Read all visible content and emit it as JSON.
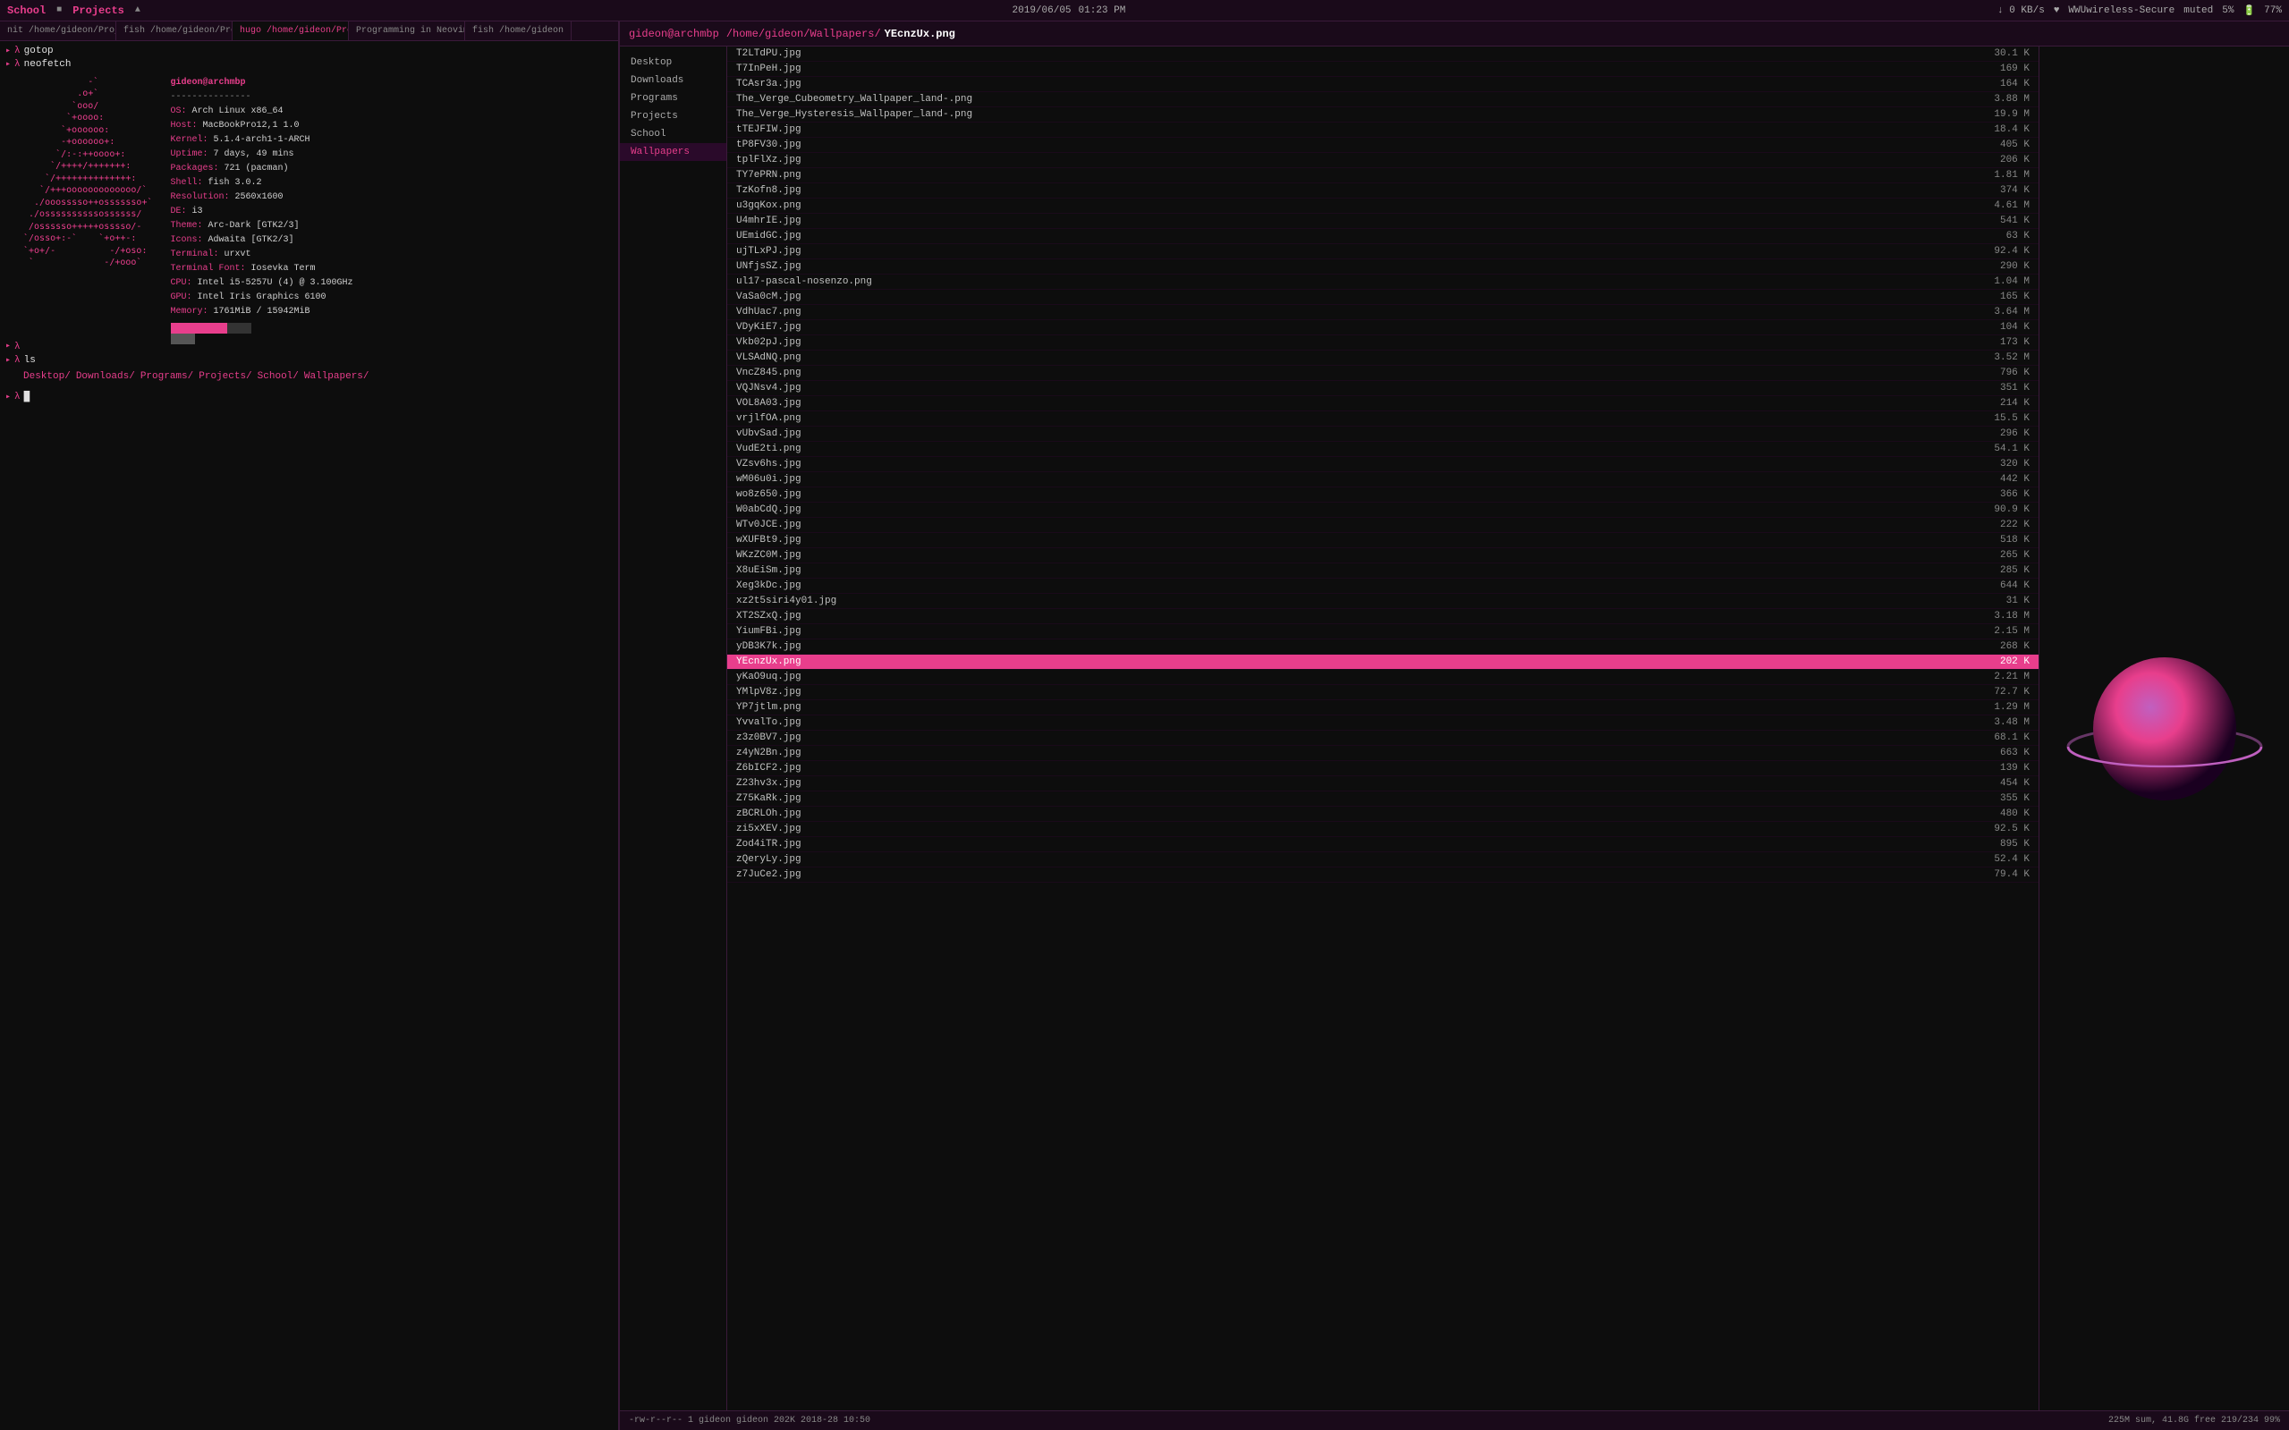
{
  "topbar": {
    "app1": "School",
    "app1_icon": "■",
    "app2": "Projects",
    "app2_icon": "▲",
    "datetime": "2019/06/05",
    "time": "01:23 PM",
    "network_down": "↓ 0 KB/s",
    "network_icon": "♥",
    "wifi": "WWUwireless-Secure",
    "muted": "muted",
    "battery_pct": "5%",
    "battery_icon": "🔋",
    "battery_level": "77%"
  },
  "terminal": {
    "tabs": [
      {
        "label": "nit /home/gideon/Projects/TechStack/Web",
        "active": false
      },
      {
        "label": "fish /home/gideon/Projects/TechStack/Web",
        "active": false
      },
      {
        "label": "hugo /home/gideon/Projects/TechStack/Web",
        "active": true
      },
      {
        "label": "Programming in Neovim :: Gideon Wolfe",
        "active": false
      },
      {
        "label": "fish /home/gideon",
        "active": false
      }
    ],
    "cmd1": "gotop",
    "cmd2": "neofetch",
    "user": "gideon@archmbp",
    "separator": "---------------",
    "sysinfo": [
      {
        "key": "OS:",
        "val": "Arch Linux x86_64"
      },
      {
        "key": "Host:",
        "val": "MacBookPro12,1 1.0"
      },
      {
        "key": "Kernel:",
        "val": "5.1.4-arch1-1-ARCH"
      },
      {
        "key": "Uptime:",
        "val": "7 days, 49 mins"
      },
      {
        "key": "Packages:",
        "val": "721 (pacman)"
      },
      {
        "key": "Shell:",
        "val": "fish 3.0.2"
      },
      {
        "key": "Resolution:",
        "val": "2560x1600"
      },
      {
        "key": "DE:",
        "val": "i3"
      },
      {
        "key": "Theme:",
        "val": "Arc-Dark [GTK2/3]"
      },
      {
        "key": "Icons:",
        "val": "Adwaita [GTK2/3]"
      },
      {
        "key": "Terminal:",
        "val": "urxvt"
      },
      {
        "key": "Terminal Font:",
        "val": "Iosevka Term"
      },
      {
        "key": "CPU:",
        "val": "Intel i5-5257U (4) @ 3.100GHz"
      },
      {
        "key": "GPU:",
        "val": "Intel Iris Graphics 6100"
      },
      {
        "key": "Memory:",
        "val": "1761MiB / 15942MiB"
      }
    ],
    "ls_dirs": [
      "Desktop/",
      "Downloads/",
      "Programs/",
      "Projects/",
      "School/",
      "Wallpapers/"
    ],
    "prompt_empty": "λ □"
  },
  "filemanager": {
    "header_user": "gideon@archmbp",
    "header_path_pre": "/home/gideon/Wallpapers/",
    "header_file": "YEcnzUx.png",
    "sidebar_items": [
      {
        "label": "Desktop",
        "active": false
      },
      {
        "label": "Downloads",
        "active": false
      },
      {
        "label": "Programs",
        "active": false
      },
      {
        "label": "Projects",
        "active": false
      },
      {
        "label": "School",
        "active": false
      },
      {
        "label": "Wallpapers",
        "active": true
      }
    ],
    "files": [
      {
        "name": "T2LTdPU.jpg",
        "size": "30.1 K"
      },
      {
        "name": "T7InPeH.jpg",
        "size": "169 K"
      },
      {
        "name": "TCAsr3a.jpg",
        "size": "164 K"
      },
      {
        "name": "The_Verge_Cubeometry_Wallpaper_land-.png",
        "size": "3.88 M"
      },
      {
        "name": "The_Verge_Hysteresis_Wallpaper_land-.png",
        "size": "19.9 M"
      },
      {
        "name": "tTEJFIW.jpg",
        "size": "18.4 K"
      },
      {
        "name": "tP8FV30.jpg",
        "size": "405 K"
      },
      {
        "name": "tplFlXz.jpg",
        "size": "206 K"
      },
      {
        "name": "TY7ePRN.png",
        "size": "1.81 M"
      },
      {
        "name": "TzKofn8.jpg",
        "size": "374 K"
      },
      {
        "name": "u3gqKox.png",
        "size": "4.61 M"
      },
      {
        "name": "U4mhrIE.jpg",
        "size": "541 K"
      },
      {
        "name": "UEmidGC.jpg",
        "size": "63 K"
      },
      {
        "name": "ujTLxPJ.jpg",
        "size": "92.4 K"
      },
      {
        "name": "UNfjsSZ.jpg",
        "size": "290 K"
      },
      {
        "name": "ul17-pascal-nosenzo.png",
        "size": "1.04 M"
      },
      {
        "name": "VaSa0cM.jpg",
        "size": "165 K"
      },
      {
        "name": "VdhUac7.png",
        "size": "3.64 M"
      },
      {
        "name": "VDyKiE7.jpg",
        "size": "104 K"
      },
      {
        "name": "Vkb02pJ.jpg",
        "size": "173 K"
      },
      {
        "name": "VLSAdNQ.png",
        "size": "3.52 M"
      },
      {
        "name": "VncZ845.png",
        "size": "796 K"
      },
      {
        "name": "VQJNsv4.jpg",
        "size": "351 K"
      },
      {
        "name": "VOL8A03.jpg",
        "size": "214 K"
      },
      {
        "name": "vrjlfOA.png",
        "size": "15.5 K"
      },
      {
        "name": "vUbvSad.jpg",
        "size": "296 K"
      },
      {
        "name": "VudE2ti.png",
        "size": "54.1 K"
      },
      {
        "name": "VZsv6hs.jpg",
        "size": "320 K"
      },
      {
        "name": "wM06u0i.jpg",
        "size": "442 K"
      },
      {
        "name": "wo8z650.jpg",
        "size": "366 K"
      },
      {
        "name": "W0abCdQ.jpg",
        "size": "90.9 K"
      },
      {
        "name": "WTv0JCE.jpg",
        "size": "222 K"
      },
      {
        "name": "wXUFBt9.jpg",
        "size": "518 K"
      },
      {
        "name": "WKzZC0M.jpg",
        "size": "265 K"
      },
      {
        "name": "X8uEiSm.jpg",
        "size": "285 K"
      },
      {
        "name": "Xeg3kDc.jpg",
        "size": "644 K"
      },
      {
        "name": "xz2t5siri4y01.jpg",
        "size": "31 K"
      },
      {
        "name": "XT2SZxQ.jpg",
        "size": "3.18 M"
      },
      {
        "name": "YiumFBi.jpg",
        "size": "2.15 M"
      },
      {
        "name": "yDB3K7k.jpg",
        "size": "268 K"
      },
      {
        "name": "YEcnzUx.png",
        "size": "202 K",
        "selected": true
      },
      {
        "name": "yKaO9uq.jpg",
        "size": "2.21 M"
      },
      {
        "name": "YMlpV8z.jpg",
        "size": "72.7 K"
      },
      {
        "name": "YP7jtlm.png",
        "size": "1.29 M"
      },
      {
        "name": "YvvalTo.jpg",
        "size": "3.48 M"
      },
      {
        "name": "z3z0BV7.jpg",
        "size": "68.1 K"
      },
      {
        "name": "z4yN2Bn.jpg",
        "size": "663 K"
      },
      {
        "name": "Z6bICF2.jpg",
        "size": "139 K"
      },
      {
        "name": "Z23hv3x.jpg",
        "size": "454 K"
      },
      {
        "name": "Z75KaRk.jpg",
        "size": "355 K"
      },
      {
        "name": "zBCRLOh.jpg",
        "size": "480 K"
      },
      {
        "name": "zi5xXEV.jpg",
        "size": "92.5 K"
      },
      {
        "name": "Zod4iTR.jpg",
        "size": "895 K"
      },
      {
        "name": "zQeryLy.jpg",
        "size": "52.4 K"
      },
      {
        "name": "z7JuCe2.jpg",
        "size": "79.4 K"
      }
    ],
    "footer_left": "-rw-r--r-- 1 gideon gideon 202K 2018-28 10:50",
    "footer_right": "225M sum, 41.8G free  219/234  99%"
  },
  "ascii_art": "            -`\n          .o+`\n         `ooo/\n        `+oooo:\n       `+oooooo:\n       -+oooooo+:\n      `/:-:++oooo+:\n     `/++++/+++++++:\n    `/++++++++++++++:\n   `/+++ooooooooooooo/`\n  ./ooosssso++osssssso+`\n ./ossssssssssossssss/\n /ossssso+++++osssso/-\n`/osso+:-`    `+o++-:\n`+o+/-          -/+oso:\n `             -/+ooo`\n"
}
